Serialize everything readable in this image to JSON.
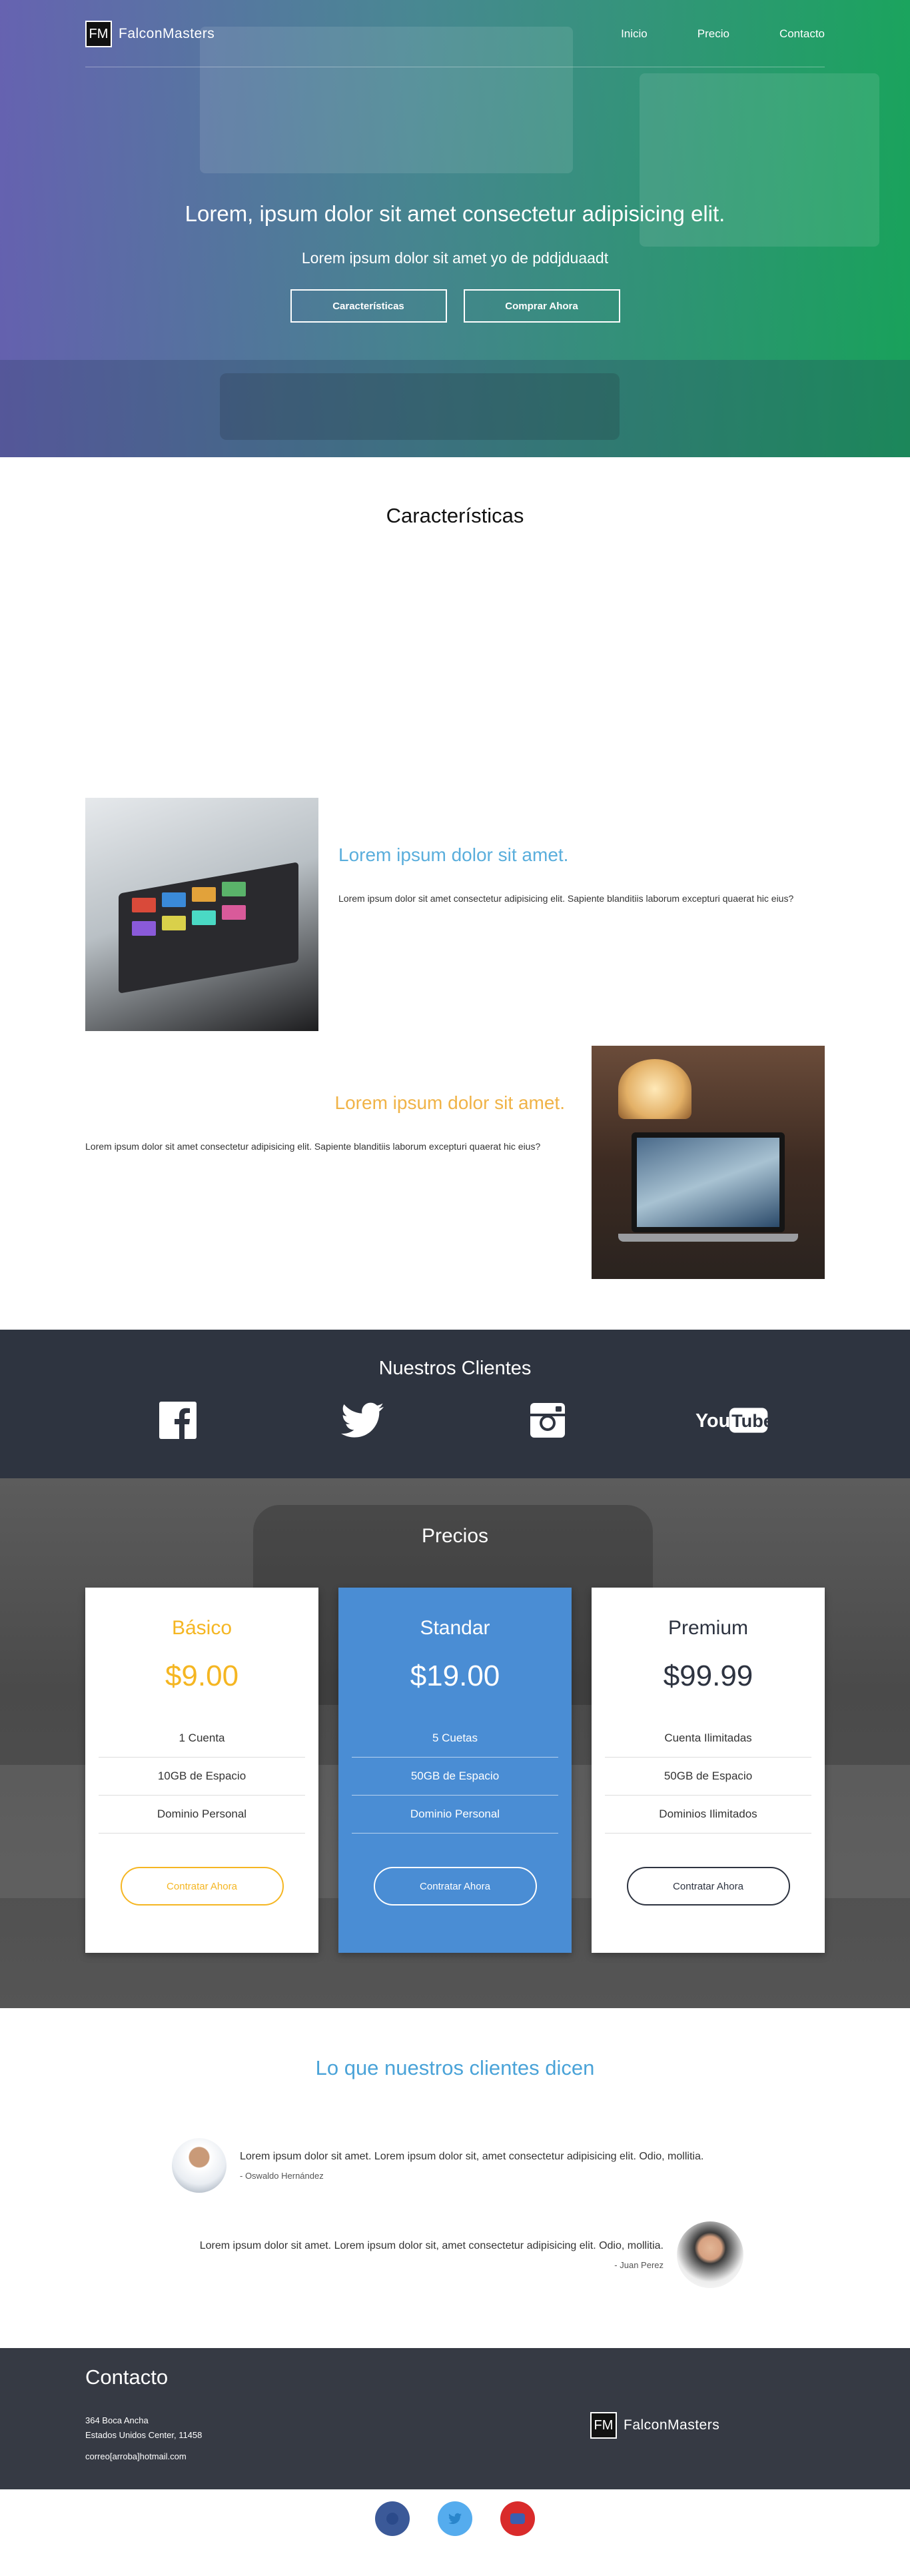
{
  "nav": {
    "logo_mark": "FM",
    "logo_text": "FalconMasters",
    "links": [
      "Inicio",
      "Precio",
      "Contacto"
    ]
  },
  "hero": {
    "title": "Lorem, ipsum dolor sit amet consectetur adipisicing elit.",
    "subtitle": "Lorem ipsum dolor sit amet yo de pddjduaadt",
    "btn_features": "Características",
    "btn_buy": "Comprar Ahora"
  },
  "features": {
    "title": "Características",
    "items": [
      {
        "heading": "Lorem ipsum dolor sit amet.",
        "body": "Lorem ipsum dolor sit amet consectetur adipisicing elit. Sapiente blanditiis laborum excepturi quaerat hic eius?",
        "image": "tablet-photo"
      },
      {
        "heading": "Lorem ipsum dolor sit amet.",
        "body": "Lorem ipsum dolor sit amet consectetur adipisicing elit. Sapiente blanditiis laborum excepturi quaerat hic eius?",
        "image": "laptop-photo"
      }
    ]
  },
  "clients": {
    "title": "Nuestros Clientes",
    "logos": [
      "facebook-logo",
      "twitter-logo",
      "instagram-logo",
      "youtube-logo"
    ],
    "youtube_you": "You",
    "youtube_tube": "Tube"
  },
  "pricing": {
    "title": "Precios",
    "plans": [
      {
        "name": "Básico",
        "price": "$9.00",
        "features": [
          "1 Cuenta",
          "10GB de Espacio",
          "Dominio Personal"
        ],
        "button": "Contratar Ahora"
      },
      {
        "name": "Standar",
        "price": "$19.00",
        "features": [
          "5 Cuetas",
          "50GB de Espacio",
          "Dominio Personal"
        ],
        "button": "Contratar Ahora"
      },
      {
        "name": "Premium",
        "price": "$99.99",
        "features": [
          "Cuenta Ilimitadas",
          "50GB de Espacio",
          "Dominios Ilimitados"
        ],
        "button": "Contratar Ahora"
      }
    ]
  },
  "testimonials": {
    "title": "Lo que nuestros clientes dicen",
    "items": [
      {
        "quote": "Lorem ipsum dolor sit amet. Lorem ipsum dolor sit, amet consectetur adipisicing elit. Odio, mollitia.",
        "author": "- Oswaldo Hernández"
      },
      {
        "quote": "Lorem ipsum dolor sit amet. Lorem ipsum dolor sit, amet consectetur adipisicing elit. Odio, mollitia.",
        "author": "- Juan Perez"
      }
    ]
  },
  "contact": {
    "title": "Contacto",
    "address1": "364 Boca Ancha",
    "address2": "Estados Unidos Center, 11458",
    "email": "correo[arroba]hotmail.com",
    "logo_mark": "FM",
    "logo_text": "FalconMasters"
  },
  "social": [
    "facebook-icon",
    "twitter-icon",
    "youtube-icon"
  ],
  "colors": {
    "accent_blue": "#4a8dd4",
    "accent_orange": "#f5b622",
    "dark": "#2e3440"
  }
}
